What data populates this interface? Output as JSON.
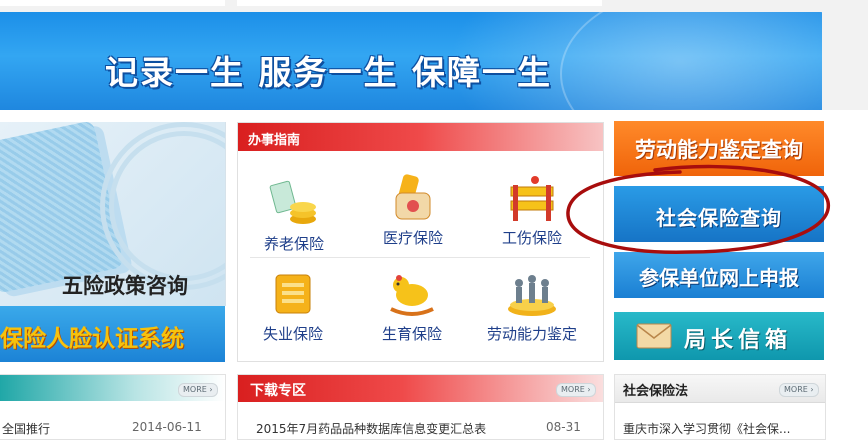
{
  "banner": {
    "slogan": "记录一生 服务一生 保障一生"
  },
  "left_panel": {
    "title": "五险政策咨询",
    "face_auth": "保险人脸认证系统"
  },
  "guide": {
    "title": "办事指南",
    "items": [
      {
        "label": "养老保险",
        "icon": "pension-icon"
      },
      {
        "label": "医疗保险",
        "icon": "medical-icon"
      },
      {
        "label": "工伤保险",
        "icon": "injury-icon"
      },
      {
        "label": "失业保险",
        "icon": "unemployment-icon"
      },
      {
        "label": "生育保险",
        "icon": "maternity-icon"
      },
      {
        "label": "劳动能力鉴定",
        "icon": "labor-appraisal-icon"
      }
    ]
  },
  "right_buttons": {
    "labor_query": "劳动能力鉴定查询",
    "social_query": "社会保险查询",
    "unit_online": "参保单位网上申报",
    "director_mailbox": "局长信箱"
  },
  "bottom": {
    "left": {
      "more": "MORE",
      "row_text": "全国推行",
      "row_date": "2014-06-11"
    },
    "middle": {
      "title": "下载专区",
      "more": "MORE",
      "row_text": "2015年7月药品品种数据库信息变更汇总表",
      "row_date": "08-31"
    },
    "right": {
      "title": "社会保险法",
      "more": "MORE",
      "row_text": "重庆市深入学习贯彻《社会保..."
    }
  },
  "colors": {
    "accent_red": "#d91f1f",
    "accent_blue": "#1c8fe8",
    "accent_orange": "#f0640a",
    "annotation_red": "#b00d0d"
  }
}
